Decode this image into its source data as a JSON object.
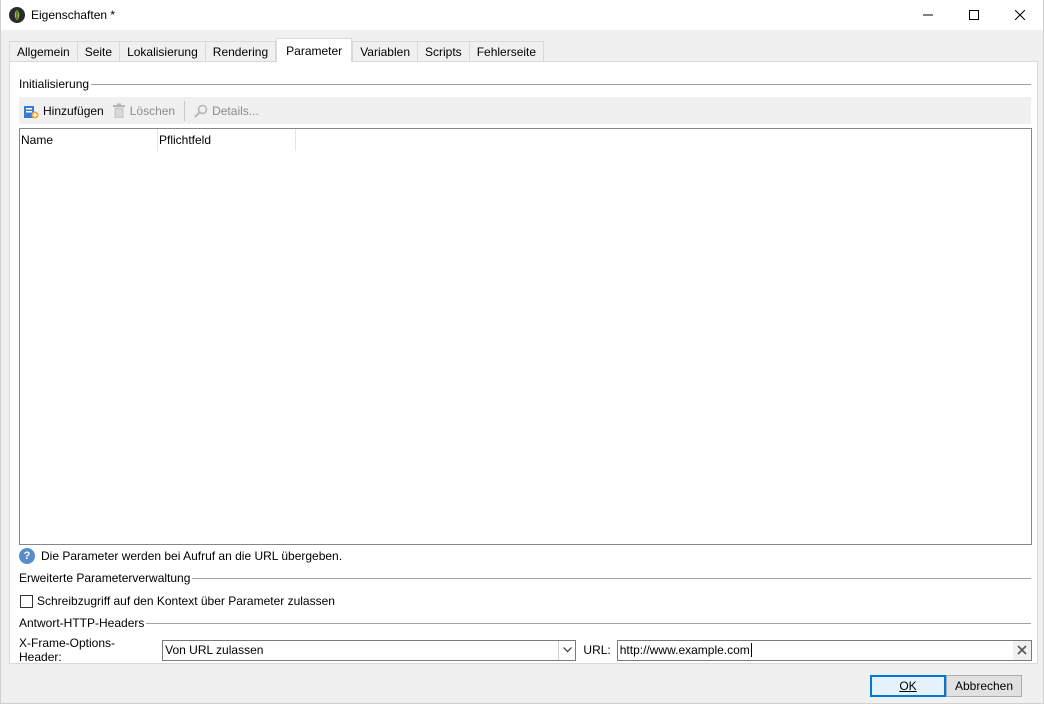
{
  "window": {
    "title": "Eigenschaften *",
    "controls": {
      "minimize": "minimize-icon",
      "maximize": "maximize-icon",
      "close": "close-icon"
    }
  },
  "tabs": [
    {
      "label": "Allgemein",
      "active": false
    },
    {
      "label": "Seite",
      "active": false
    },
    {
      "label": "Lokalisierung",
      "active": false
    },
    {
      "label": "Rendering",
      "active": false
    },
    {
      "label": "Parameter",
      "active": true
    },
    {
      "label": "Variablen",
      "active": false
    },
    {
      "label": "Scripts",
      "active": false
    },
    {
      "label": "Fehlerseite",
      "active": false
    }
  ],
  "initialization": {
    "group_label": "Initialisierung",
    "toolbar": {
      "add_label": "Hinzufügen",
      "delete_label": "Löschen",
      "details_label": "Details..."
    },
    "columns": [
      "Name",
      "Pflichtfeld"
    ],
    "rows": [],
    "info_text": "Die Parameter werden bei Aufruf an die URL übergeben."
  },
  "advanced": {
    "group_label": "Erweiterte Parameterverwaltung",
    "checkbox_label": "Schreibzugriff auf den Kontext über Parameter zulassen",
    "checkbox_checked": false
  },
  "http_headers": {
    "group_label": "Antwort-HTTP-Headers",
    "xframe_label": "X-Frame-Options-Header:",
    "xframe_value": "Von URL zulassen",
    "url_label": "URL:",
    "url_value": "http://www.example.com"
  },
  "buttons": {
    "ok_label": "OK",
    "cancel_label": "Abbrechen"
  },
  "colors": {
    "accent": "#0078d7",
    "info_icon": "#5a8ccc"
  }
}
